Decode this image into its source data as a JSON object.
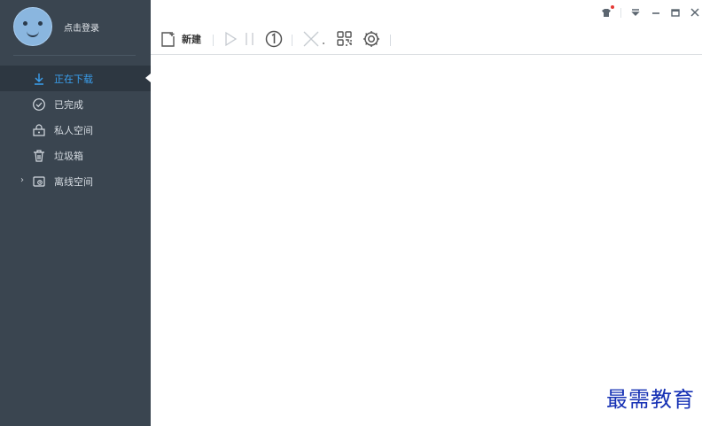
{
  "sidebar": {
    "login_label": "点击登录",
    "items": [
      {
        "label": "正在下载",
        "icon": "download-icon",
        "active": true
      },
      {
        "label": "已完成",
        "icon": "check-circle-icon"
      },
      {
        "label": "私人空间",
        "icon": "lock-icon"
      },
      {
        "label": "垃圾箱",
        "icon": "trash-icon"
      },
      {
        "label": "离线空间",
        "icon": "cloud-folder-icon",
        "expandable": true
      }
    ],
    "colors": {
      "background": "#3a4550",
      "active_bg": "#2d3741",
      "active_text": "#3aa0f0"
    }
  },
  "titlebar": {
    "icons": [
      "skin-icon",
      "menu-icon",
      "minimize-icon",
      "maximize-icon",
      "close-icon"
    ],
    "notification_dot_color": "#e53935"
  },
  "toolbar": {
    "new_label": "新建",
    "icons": [
      "new-task-icon",
      "start-icon",
      "pause-icon",
      "speed-limit-icon",
      "delete-icon",
      "qr-code-icon",
      "settings-icon"
    ]
  },
  "watermark": "最需教育"
}
